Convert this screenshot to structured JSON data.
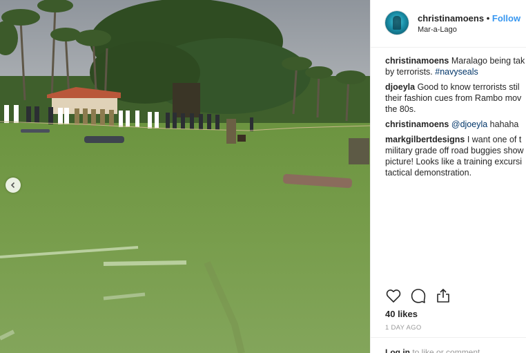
{
  "post": {
    "username": "christinamoens",
    "separator": "•",
    "follow_label": "Follow",
    "location": "Mar-a-Lago"
  },
  "comments": [
    {
      "user": "christinamoens",
      "text": "Maralago being tak",
      "text2": "by terrorists. ",
      "tag": "#navyseals"
    },
    {
      "user": "djoeyla",
      "text": "Good to know terrorists stil",
      "text2": "their fashion cues from Rambo mov",
      "text3": "the 80s."
    },
    {
      "user": "christinamoens",
      "mention": "@djoeyla",
      "text": " hahaha"
    },
    {
      "user": "markgilbertdesigns",
      "text": "I want one of t",
      "text2": "military grade off road buggies show",
      "text3": "picture! Looks like a training excursi",
      "text4": "tactical demonstration."
    }
  ],
  "likes": "40 likes",
  "time": "1 DAY AGO",
  "footer": {
    "login": "Log in",
    "rest": " to like or comment."
  },
  "icons": [
    "heart-icon",
    "comment-icon",
    "share-icon",
    "chevron-left-icon"
  ]
}
